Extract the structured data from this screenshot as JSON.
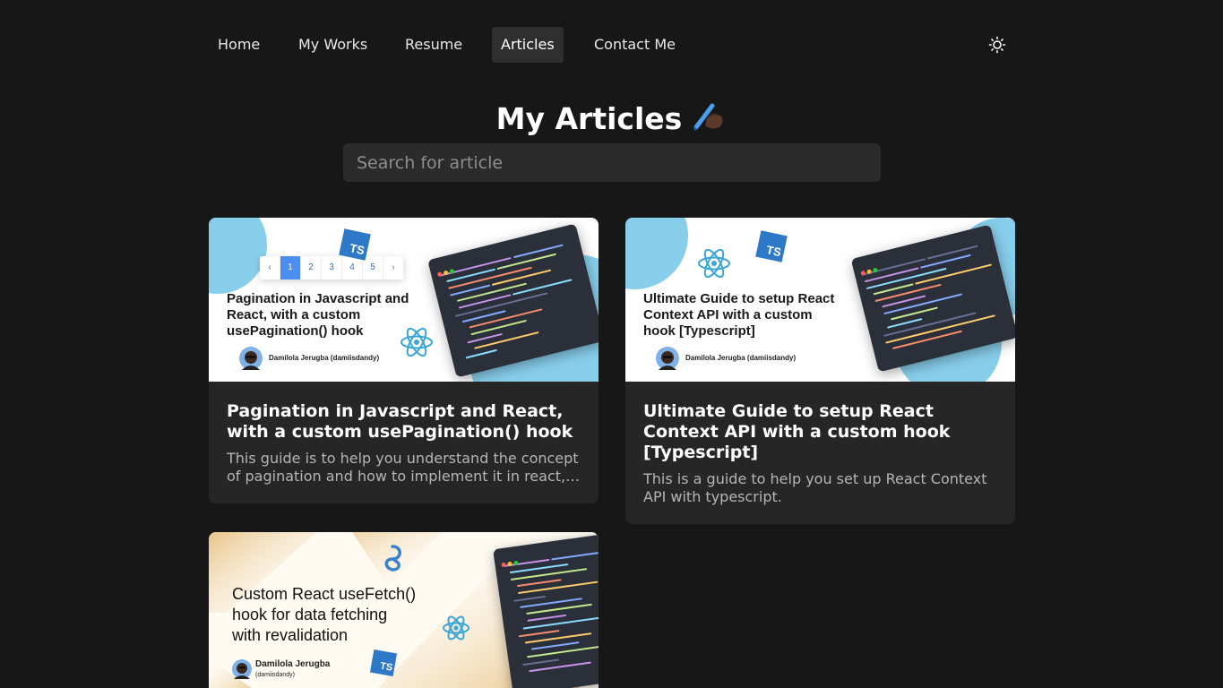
{
  "nav": {
    "items": [
      {
        "label": "Home"
      },
      {
        "label": "My Works"
      },
      {
        "label": "Resume"
      },
      {
        "label": "Articles",
        "active": true
      },
      {
        "label": "Contact Me"
      }
    ],
    "theme_toggle_icon": "sun-icon"
  },
  "header": {
    "title": "My Articles",
    "emoji_icon": "writing-hand-icon"
  },
  "search": {
    "placeholder": "Search for article",
    "value": ""
  },
  "articles": [
    {
      "title": "Pagination in Javascript and React, with a custom usePagination() hook",
      "description": "This guide is to help you understand the concept of pagination and how to implement it in react, the...",
      "thumbnail": {
        "headline_lines": [
          "Pagination in Javascript and",
          "React, with a custom",
          "usePagination() hook"
        ],
        "author": "Damilola Jerugba (damiisdandy)",
        "pager": [
          "‹",
          "1",
          "2",
          "3",
          "4",
          "5",
          "›"
        ],
        "badge": "TS"
      }
    },
    {
      "title": "Ultimate Guide to setup React Context API with a custom hook [Typescript]",
      "description": "This is a guide to help you set up React Context API with typescript.",
      "thumbnail": {
        "headline_lines": [
          "Ultimate Guide to setup React",
          "Context API with a custom",
          "hook [Typescript]"
        ],
        "author": "Damilola Jerugba (damiisdandy)",
        "badge": "TS"
      }
    },
    {
      "title": "",
      "description": "",
      "thumbnail": {
        "headline_lines": [
          "Custom React useFetch()",
          "hook for data fetching",
          "with revalidation"
        ],
        "author_name": "Damilola Jerugba",
        "author_handle": "(damiisdandy)",
        "badge": "TS"
      }
    }
  ],
  "colors": {
    "background": "#171717",
    "card": "#262626",
    "accent_blue": "#87ceeb",
    "react_blue": "#3aa6d8",
    "ts_blue": "#2d79c7",
    "gold": "#e2b56a"
  }
}
